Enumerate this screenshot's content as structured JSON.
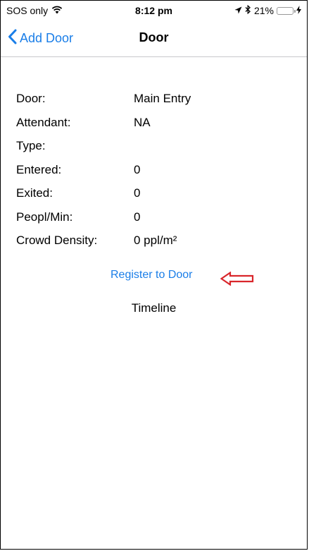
{
  "status_bar": {
    "carrier": "SOS only",
    "time": "8:12 pm",
    "battery_percent": "21%",
    "battery_level": 0.21,
    "battery_color": "#f5d000",
    "icons": [
      "wifi-icon",
      "location-icon",
      "bluetooth-icon",
      "battery-icon",
      "charging-icon"
    ]
  },
  "nav": {
    "back_label": "Add Door",
    "title": "Door",
    "accent_color": "#1a7ee8"
  },
  "details": [
    {
      "label": "Door:",
      "value": "Main Entry"
    },
    {
      "label": "Attendant:",
      "value": "NA"
    },
    {
      "label": "Type:",
      "value": ""
    },
    {
      "label": "Entered:",
      "value": "0"
    },
    {
      "label": "Exited:",
      "value": "0"
    },
    {
      "label": "Peopl/Min:",
      "value": "0"
    },
    {
      "label": "Crowd Density:",
      "value": "0 ppl/m²"
    }
  ],
  "actions": {
    "register_label": "Register to Door",
    "arrow_color": "#d9262b"
  },
  "timeline": {
    "label": "Timeline"
  }
}
